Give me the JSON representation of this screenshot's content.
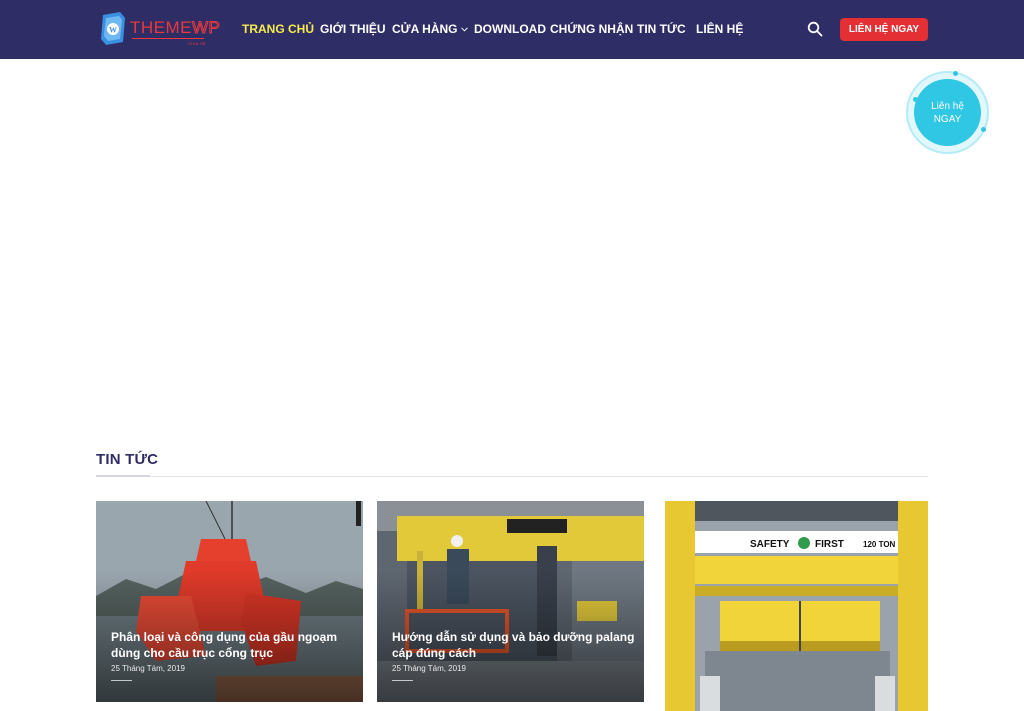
{
  "brand": {
    "logo_text_a": "THEME",
    "logo_text_b": "WP",
    "logo_sub": "CHIA SẺ",
    "accent": "#e42f35",
    "header_bg": "#2e2d66",
    "active_nav": "#f7ec4d"
  },
  "nav": {
    "items": [
      {
        "label": "TRANG CHỦ",
        "active": true
      },
      {
        "label": "GIỚI THIỆU"
      },
      {
        "label": "CỬA HÀNG",
        "has_dropdown": true
      },
      {
        "label": "DOWNLOAD"
      },
      {
        "label": "CHỨNG NHẬN"
      },
      {
        "label": "TIN TỨC"
      },
      {
        "label": "LIÊN HỆ"
      }
    ],
    "search_icon": "search-icon",
    "cta_label": "LIÊN HỆ NGAY"
  },
  "float_contact": {
    "line1": "Liên hệ",
    "line2": "NGAY",
    "color": "#2fc7e4"
  },
  "news": {
    "heading": "TIN TỨC",
    "posts": [
      {
        "title": "Phân loại và công dụng của gầu ngoạm dùng cho cầu trục cổng trục",
        "date": "25 Tháng Tám, 2019"
      },
      {
        "title": "Hướng dẫn sử dụng và bảo dưỡng palang cáp đúng cách",
        "date": "25 Tháng Tám, 2019"
      },
      {
        "sign_text": "SAFETY",
        "sign_text_2": "FIRST",
        "sign_tonnage": "120 TON"
      }
    ]
  }
}
